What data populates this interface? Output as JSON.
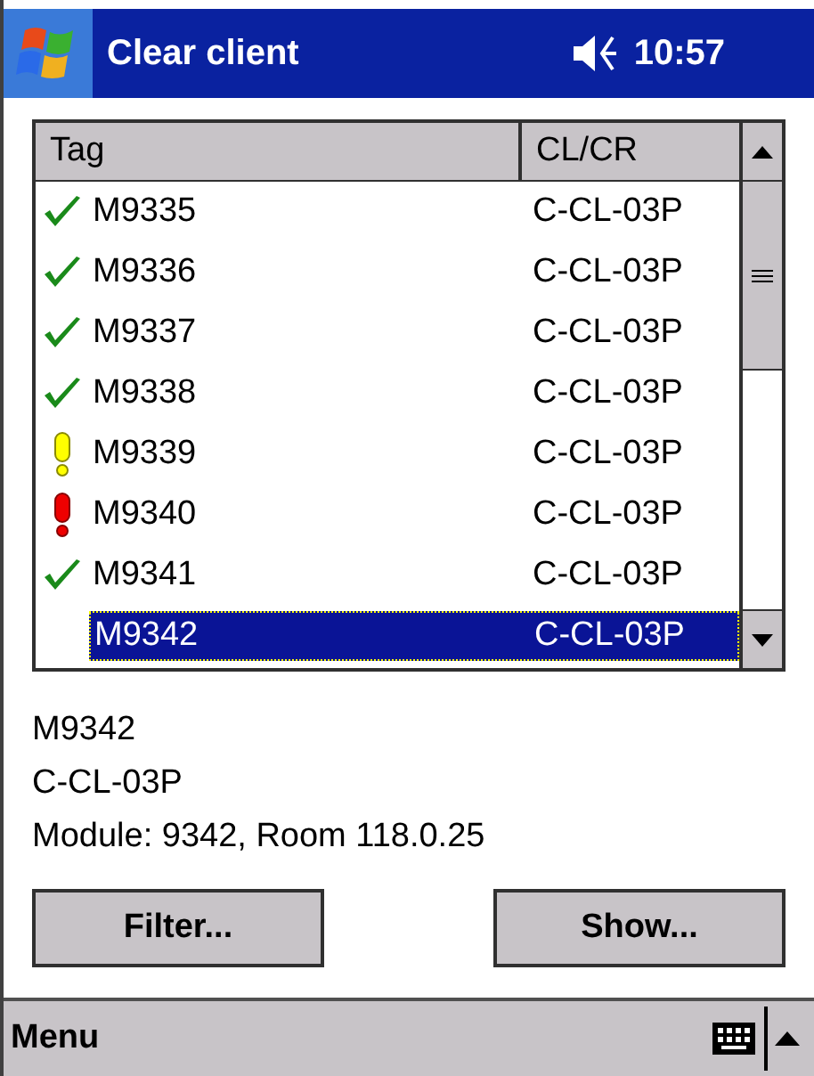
{
  "title_bar": {
    "title": "Clear client",
    "time": "10:57"
  },
  "list": {
    "columns": [
      "Tag",
      "CL/CR"
    ],
    "rows": [
      {
        "kind": "ok",
        "tag": "M9335",
        "clcr": "C-CL-03P",
        "selected": false
      },
      {
        "kind": "ok",
        "tag": "M9336",
        "clcr": "C-CL-03P",
        "selected": false
      },
      {
        "kind": "ok",
        "tag": "M9337",
        "clcr": "C-CL-03P",
        "selected": false
      },
      {
        "kind": "ok",
        "tag": "M9338",
        "clcr": "C-CL-03P",
        "selected": false
      },
      {
        "kind": "warning",
        "tag": "M9339",
        "clcr": "C-CL-03P",
        "selected": false
      },
      {
        "kind": "error",
        "tag": "M9340",
        "clcr": "C-CL-03P",
        "selected": false
      },
      {
        "kind": "ok",
        "tag": "M9341",
        "clcr": "C-CL-03P",
        "selected": false
      },
      {
        "kind": "plain",
        "tag": "M9342",
        "clcr": "C-CL-03P",
        "selected": true
      }
    ]
  },
  "details": [
    "M9342",
    "C-CL-03P",
    "Module: 9342, Room 118.0.25"
  ],
  "buttons": [
    "Filter...",
    "Show..."
  ],
  "menu_bar": {
    "menu": "Menu"
  }
}
